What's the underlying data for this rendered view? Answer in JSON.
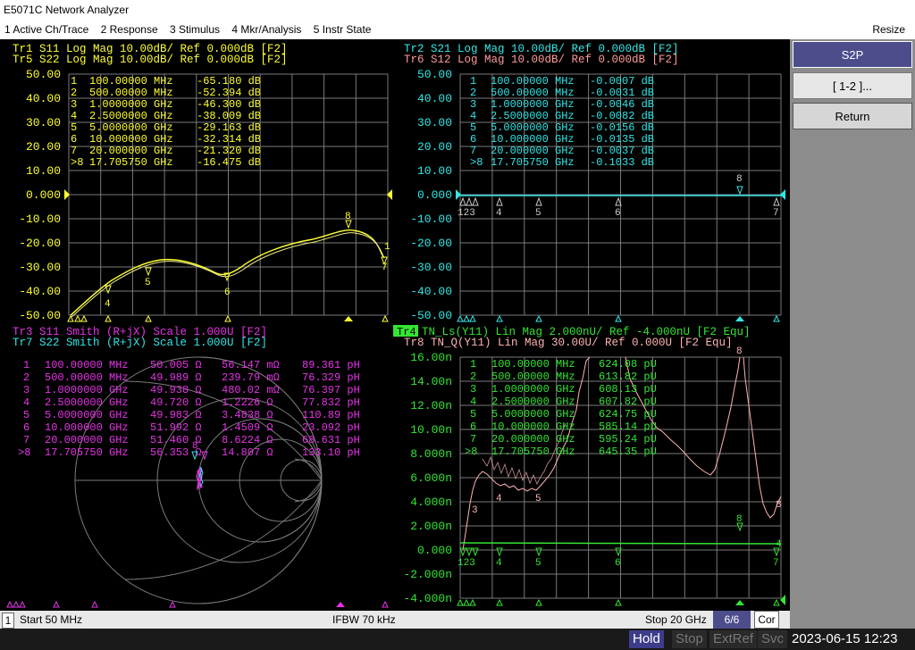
{
  "app": {
    "title": "E5071C Network Analyzer"
  },
  "menu": {
    "items": [
      "1 Active Ch/Trace",
      "2 Response",
      "3 Stimulus",
      "4 Mkr/Analysis",
      "5 Instr State"
    ],
    "resize": "Resize"
  },
  "colors": {
    "yellow": "#ffff33",
    "cyan": "#33e6e6",
    "magenta": "#e633e6",
    "green": "#33e633",
    "pink": "#ffb3b3",
    "grid": "#808080"
  },
  "softkeys": {
    "title": "S2P",
    "item1": "[ 1-2 ]...",
    "return": "Return"
  },
  "status": {
    "ch": "1",
    "start": "Start 50 MHz",
    "ifbw": "IFBW 70 kHz",
    "stop": "Stop 20 GHz",
    "count": "6/6",
    "cor": "Cor"
  },
  "bottom": {
    "hold": "Hold",
    "stop": "Stop",
    "extref": "ExtRef",
    "svc": "Svc",
    "datetime": "2023-06-15 12:23"
  },
  "panels": {
    "p1": {
      "h1": "Tr1 S11 Log Mag 10.00dB/ Ref 0.000dB [F2]",
      "h2": "Tr5 S22 Log Mag 10.00dB/ Ref 0.000dB [F2]",
      "yticks": [
        "50.00",
        "40.00",
        "30.00",
        "20.00",
        "10.00",
        "0.000",
        "-10.00",
        "-20.00",
        "-30.00",
        "-40.00",
        "-50.00"
      ],
      "markers": [
        {
          "n": "1",
          "f": "100.00000 MHz",
          "v": "-65.180 dB"
        },
        {
          "n": "2",
          "f": "500.00000 MHz",
          "v": "-52.394 dB"
        },
        {
          "n": "3",
          "f": "1.0000000 GHz",
          "v": "-46.300 dB"
        },
        {
          "n": "4",
          "f": "2.5000000 GHz",
          "v": "-38.009 dB"
        },
        {
          "n": "5",
          "f": "5.0000000 GHz",
          "v": "-29.163 dB"
        },
        {
          "n": "6",
          "f": "10.000000 GHz",
          "v": "-32.314 dB"
        },
        {
          "n": "7",
          "f": "20.000000 GHz",
          "v": "-21.320 dB"
        },
        {
          "n": ">8",
          "f": "17.705750 GHz",
          "v": "-16.475 dB"
        }
      ]
    },
    "p2": {
      "h1": "Tr2 S21 Log Mag 10.00dB/ Ref 0.000dB [F2]",
      "h2": "Tr6 S12 Log Mag 10.00dB/ Ref 0.000dB [F2]",
      "yticks": [
        "50.00",
        "40.00",
        "30.00",
        "20.00",
        "10.00",
        "0.000",
        "-10.00",
        "-20.00",
        "-30.00",
        "-40.00",
        "-50.00"
      ],
      "markers": [
        {
          "n": "1",
          "f": "100.00000 MHz",
          "v": "-0.0007 dB"
        },
        {
          "n": "2",
          "f": "500.00000 MHz",
          "v": "-0.0031 dB"
        },
        {
          "n": "3",
          "f": "1.0000000 GHz",
          "v": "-0.0046 dB"
        },
        {
          "n": "4",
          "f": "2.5000000 GHz",
          "v": "-0.0082 dB"
        },
        {
          "n": "5",
          "f": "5.0000000 GHz",
          "v": "-0.0156 dB"
        },
        {
          "n": "6",
          "f": "10.000000 GHz",
          "v": "-0.0135 dB"
        },
        {
          "n": "7",
          "f": "20.000000 GHz",
          "v": "-0.0037 dB"
        },
        {
          "n": ">8",
          "f": "17.705750 GHz",
          "v": "-0.1033 dB"
        }
      ]
    },
    "p3": {
      "h1": "Tr3 S11 Smith (R+jX) Scale 1.000U [F2]",
      "h2": "Tr7 S22 Smith (R+jX) Scale 1.000U [F2]",
      "markers": [
        {
          "n": "1",
          "f": "100.00000 MHz",
          "r": "50.005 Ω",
          "x": "56.147 mΩ",
          "l": "89.361 pH"
        },
        {
          "n": "2",
          "f": "500.00000 MHz",
          "r": "49.989 Ω",
          "x": "239.79 mΩ",
          "l": "76.329 pH"
        },
        {
          "n": "3",
          "f": "1.0000000 GHz",
          "r": "49.938 Ω",
          "x": "480.02 mΩ",
          "l": "76.397 pH"
        },
        {
          "n": "4",
          "f": "2.5000000 GHz",
          "r": "49.720 Ω",
          "x": "1.2226 Ω",
          "l": "77.832 pH"
        },
        {
          "n": "5",
          "f": "5.0000000 GHz",
          "r": "49.983 Ω",
          "x": "3.4838 Ω",
          "l": "110.89 pH"
        },
        {
          "n": "6",
          "f": "10.000000 GHz",
          "r": "51.992 Ω",
          "x": "1.4509 Ω",
          "l": "23.092 pH"
        },
        {
          "n": "7",
          "f": "20.000000 GHz",
          "r": "51.460 Ω",
          "x": "8.6224 Ω",
          "l": "68.631 pH"
        },
        {
          "n": ">8",
          "f": "17.705750 GHz",
          "r": "56.353 Ω",
          "x": "14.807 Ω",
          "l": "133.10 pH"
        }
      ]
    },
    "p4": {
      "tag": "Tr4",
      "h1": "TN_Ls(Y11) Lin Mag 2.000nU/ Ref -4.000nU [F2 Equ]",
      "h2": "Tr8 TN_Q(Y11) Lin Mag 30.00U/ Ref 0.000U [F2 Equ]",
      "yticks": [
        "16.00n",
        "14.00n",
        "12.00n",
        "10.00n",
        "8.000n",
        "6.000n",
        "4.000n",
        "2.000n",
        "0.000",
        "-2.000n",
        "-4.000n"
      ],
      "markers": [
        {
          "n": "1",
          "f": "100.00000 MHz",
          "v": "624.08 pU"
        },
        {
          "n": "2",
          "f": "500.00000 MHz",
          "v": "613.82 pU"
        },
        {
          "n": "3",
          "f": "1.0000000 GHz",
          "v": "608.13 pU"
        },
        {
          "n": "4",
          "f": "2.5000000 GHz",
          "v": "607.82 pU"
        },
        {
          "n": "5",
          "f": "5.0000000 GHz",
          "v": "624.75 pU"
        },
        {
          "n": "6",
          "f": "10.000000 GHz",
          "v": "585.14 pU"
        },
        {
          "n": "7",
          "f": "20.000000 GHz",
          "v": "595.24 pU"
        },
        {
          "n": ">8",
          "f": "17.705750 GHz",
          "v": "645.35 pU"
        }
      ]
    }
  }
}
